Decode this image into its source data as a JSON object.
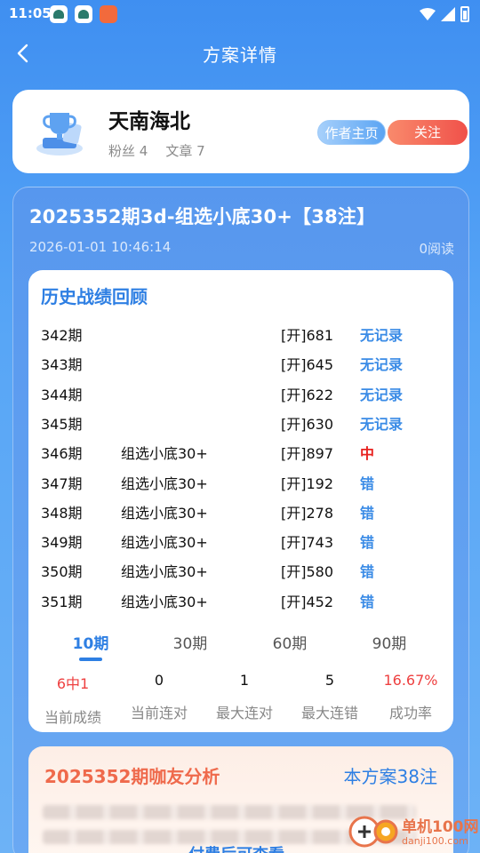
{
  "status_bar": {
    "time": "11:05"
  },
  "nav": {
    "title": "方案详情"
  },
  "author": {
    "name": "天南海北",
    "fans": "粉丝 4",
    "articles": "文章 7",
    "home_label": "作者主页",
    "follow_label": "关注"
  },
  "plan": {
    "title": "2025352期3d-组选小底30+【38注】",
    "time": "2026-01-01 10:46:14",
    "reads": "0阅读"
  },
  "history": {
    "title": "历史战绩回顾",
    "rows": [
      {
        "issue": "342期",
        "pick": "",
        "open": "[开]681",
        "result": "无记录"
      },
      {
        "issue": "343期",
        "pick": "",
        "open": "[开]645",
        "result": "无记录"
      },
      {
        "issue": "344期",
        "pick": "",
        "open": "[开]622",
        "result": "无记录"
      },
      {
        "issue": "345期",
        "pick": "",
        "open": "[开]630",
        "result": "无记录"
      },
      {
        "issue": "346期",
        "pick": "组选小底30+",
        "open": "[开]897",
        "result": "中"
      },
      {
        "issue": "347期",
        "pick": "组选小底30+",
        "open": "[开]192",
        "result": "错"
      },
      {
        "issue": "348期",
        "pick": "组选小底30+",
        "open": "[开]278",
        "result": "错"
      },
      {
        "issue": "349期",
        "pick": "组选小底30+",
        "open": "[开]743",
        "result": "错"
      },
      {
        "issue": "350期",
        "pick": "组选小底30+",
        "open": "[开]580",
        "result": "错"
      },
      {
        "issue": "351期",
        "pick": "组选小底30+",
        "open": "[开]452",
        "result": "错"
      }
    ],
    "colors": {
      "hit": "#e8221f",
      "miss": "#3a8be6"
    },
    "tabs": [
      "10期",
      "30期",
      "60期",
      "90期"
    ],
    "active_tab": 0,
    "stats": [
      {
        "value": "6中1",
        "label": "当前成绩"
      },
      {
        "value": "0",
        "label": "当前连对"
      },
      {
        "value": "1",
        "label": "最大连对"
      },
      {
        "value": "5",
        "label": "最大连错"
      },
      {
        "value": "16.67%",
        "label": "成功率"
      }
    ]
  },
  "analysis": {
    "title": "2025352期咖友分析",
    "count": "本方案38注",
    "unlock_text": "付费后可查看"
  },
  "watermark": {
    "text1": "单机100网",
    "text2": "danji100.com"
  }
}
